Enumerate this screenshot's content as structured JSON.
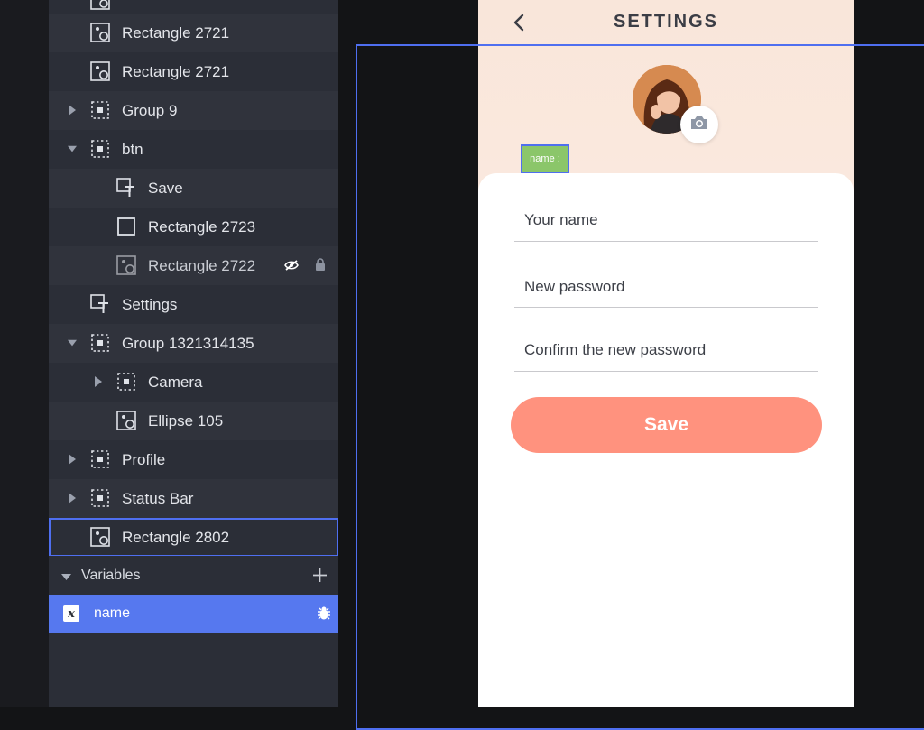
{
  "layers": [
    {
      "label": "Rectangle 2721",
      "icon": "image-layer-icon",
      "indent": 1,
      "caret": "none"
    },
    {
      "label": "Rectangle 2721",
      "icon": "image-layer-icon",
      "indent": 1,
      "caret": "none"
    },
    {
      "label": "Group 9",
      "icon": "group-layer-icon",
      "indent": 1,
      "caret": "collapsed"
    },
    {
      "label": "btn",
      "icon": "group-layer-icon",
      "indent": 1,
      "caret": "expanded"
    },
    {
      "label": "Save",
      "icon": "text-layer-icon",
      "indent": 2,
      "caret": "none"
    },
    {
      "label": "Rectangle 2723",
      "icon": "rectangle-layer-icon",
      "indent": 2,
      "caret": "none"
    },
    {
      "label": "Rectangle 2722",
      "icon": "image-layer-icon",
      "indent": 2,
      "caret": "none",
      "hidden": true,
      "locked": true
    },
    {
      "label": "Settings",
      "icon": "text-layer-icon",
      "indent": 1,
      "caret": "none"
    },
    {
      "label": "Group 1321314135",
      "icon": "group-layer-icon",
      "indent": 1,
      "caret": "expanded"
    },
    {
      "label": "Camera",
      "icon": "group-layer-icon",
      "indent": 2,
      "caret": "collapsed"
    },
    {
      "label": "Ellipse 105",
      "icon": "image-layer-icon",
      "indent": 2,
      "caret": "none"
    },
    {
      "label": "Profile",
      "icon": "group-layer-icon",
      "indent": 1,
      "caret": "collapsed"
    },
    {
      "label": "Status Bar",
      "icon": "group-layer-icon",
      "indent": 1,
      "caret": "collapsed"
    },
    {
      "label": "Rectangle 2802",
      "icon": "image-layer-icon",
      "indent": 1,
      "caret": "none",
      "selected": true
    }
  ],
  "variables": {
    "header": "Variables",
    "add_icon": "plus-icon",
    "items": [
      {
        "label": "name",
        "icon": "variable-x-icon",
        "action_icon": "bug-icon"
      }
    ]
  },
  "phone": {
    "title": "SETTINGS",
    "back_icon": "chevron-left-icon",
    "camera_icon": "camera-icon",
    "name_tag": "name :",
    "fields": [
      {
        "label": "Your name"
      },
      {
        "label": "New password"
      },
      {
        "label": "Confirm the new password"
      }
    ],
    "save_label": "Save"
  },
  "colors": {
    "accent": "#5678ef",
    "save_button": "#ff927e",
    "name_tag": "#8bc66a",
    "panel_bg": "#2b2e37"
  }
}
